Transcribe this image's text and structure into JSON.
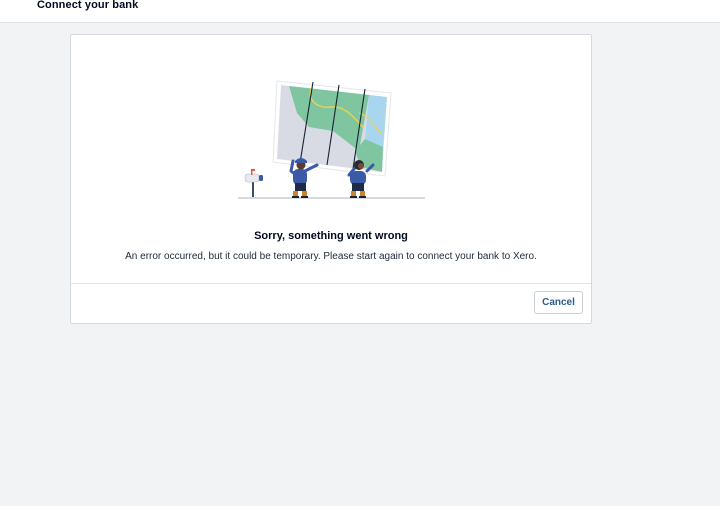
{
  "header": {
    "title": "Connect your bank"
  },
  "dialog": {
    "illustration_icon": "map-people-illustration",
    "error_title": "Sorry, something went wrong",
    "error_message": "An error occurred, but it could be temporary. Please start again to connect your bank to Xero.",
    "cancel_label": "Cancel"
  },
  "colors": {
    "background": "#f2f3f4",
    "card": "#ffffff",
    "cancel_text": "#2b5a8c",
    "map_green": "#7fc6a0",
    "map_blue": "#a7d6ee",
    "map_grey": "#d8dbe4",
    "map_road": "#f2d14a",
    "figure_blue": "#3a5aa8"
  }
}
